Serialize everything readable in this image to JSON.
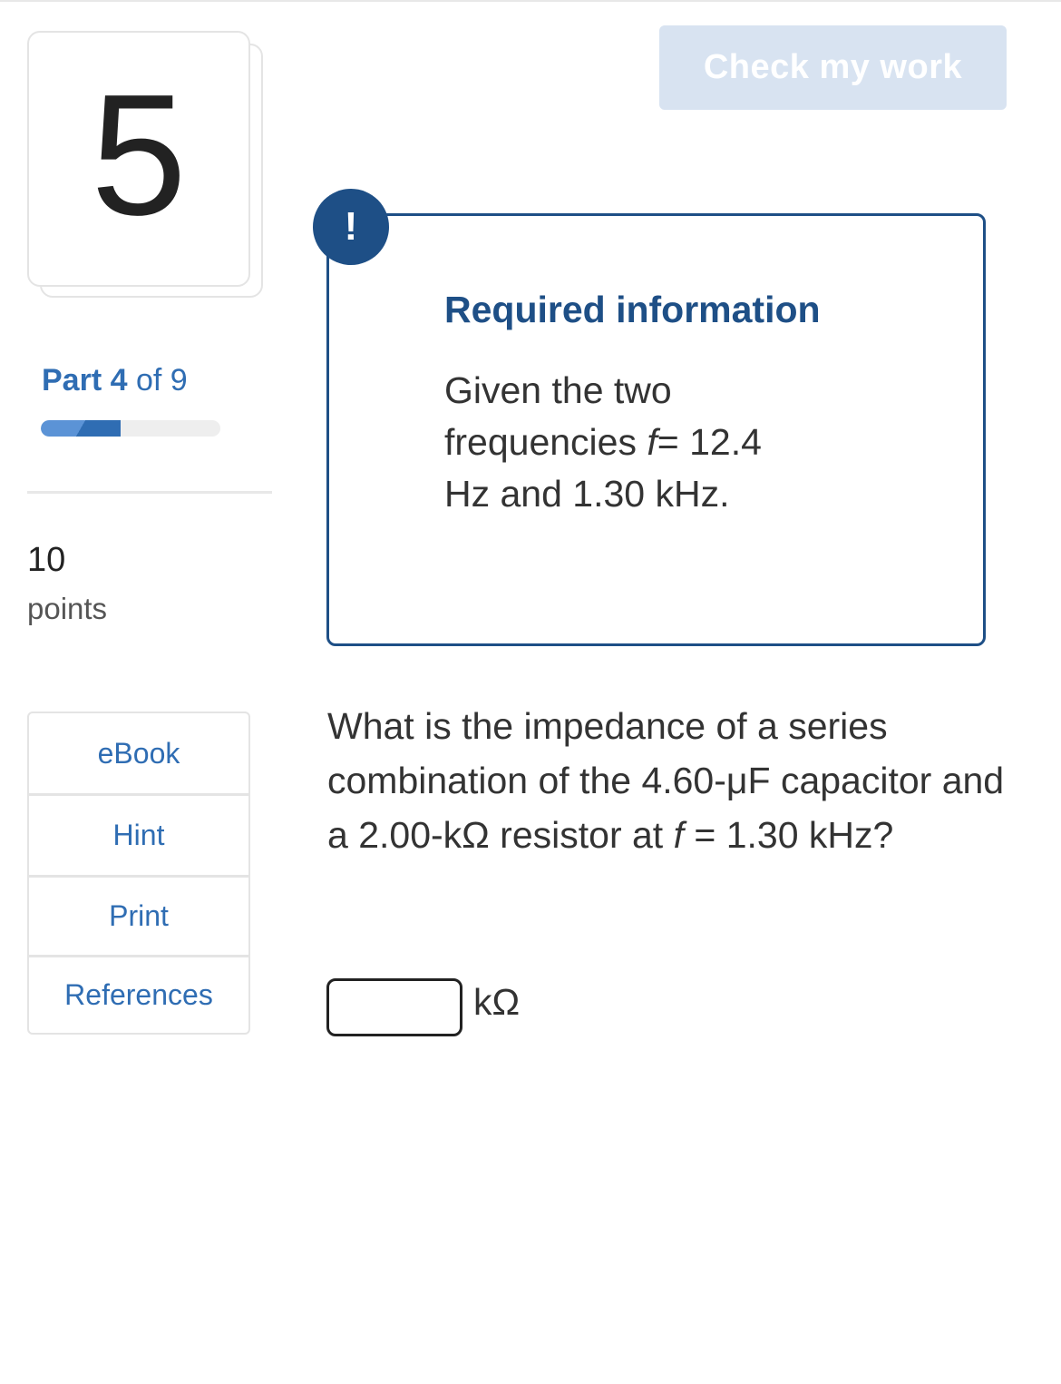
{
  "question_number": "5",
  "part": {
    "word": "Part",
    "current": "4",
    "of_word": "of",
    "total": "9",
    "progress_fraction": 0.4444
  },
  "points": {
    "value": "10",
    "label": "points"
  },
  "resources": [
    "eBook",
    "Hint",
    "Print",
    "References"
  ],
  "check_button": "Check my work",
  "alert_icon": "!",
  "required_info": {
    "title": "Required information",
    "line1": "Given the two",
    "line2_prefix": "frequencies ",
    "line2_var": "f",
    "line2_suffix": "= 12.4",
    "line3": "Hz and 1.30 kHz."
  },
  "question": {
    "part1": "What is the impedance of a series combination of the 4.60-μF capacitor and a 2.00-kΩ resistor at ",
    "var": "f",
    "part2": " = 1.30 kHz?"
  },
  "answer": {
    "value": "",
    "unit": "kΩ"
  },
  "colors": {
    "accent": "#2f6db3",
    "dark_accent": "#1e4f86",
    "button_disabled": "#d8e3f1",
    "border": "#e4e4e4"
  }
}
